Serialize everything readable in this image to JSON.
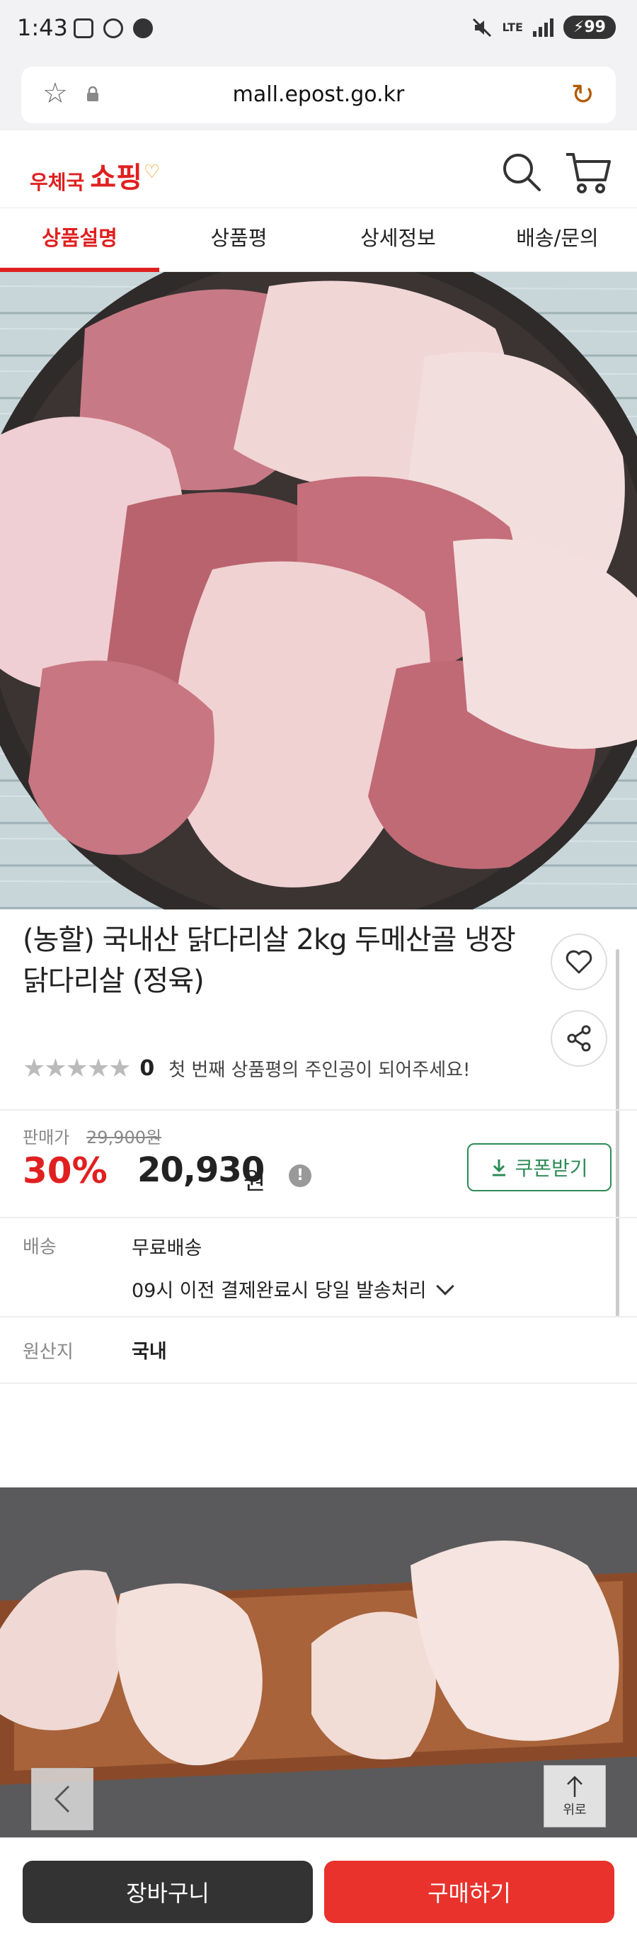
{
  "status_bar": {
    "time": "1:43",
    "network": "LTE",
    "battery": "99"
  },
  "browser": {
    "url": "mall.epost.go.kr"
  },
  "site": {
    "logo_prefix": "우체국",
    "logo_main": "쇼핑",
    "accent_color": "#e02020"
  },
  "tabs": [
    {
      "label": "상품설명",
      "active": true
    },
    {
      "label": "상품평",
      "active": false
    },
    {
      "label": "상세정보",
      "active": false
    },
    {
      "label": "배송/문의",
      "active": false
    }
  ],
  "product": {
    "title": "(농할) 국내산 닭다리살 2kg 두메산골 냉장 닭다리살 (정육)",
    "rating_count": "0",
    "rating_message": "첫 번째 상품평의 주인공이 되어주세요!",
    "price_label": "판매가",
    "original_price": "29,900원",
    "discount": "30%",
    "sale_price": "20,930",
    "currency": "원",
    "coupon_label": "쿠폰받기",
    "shipping_label": "배송",
    "shipping_value": "무료배송",
    "shipping_note": "09시 이전 결제완료시 당일 발송처리",
    "origin_label": "원산지",
    "origin_value": "국내"
  },
  "floating": {
    "top_label": "위로"
  },
  "bottom_bar": {
    "cart_label": "장바구니",
    "buy_label": "구매하기"
  }
}
